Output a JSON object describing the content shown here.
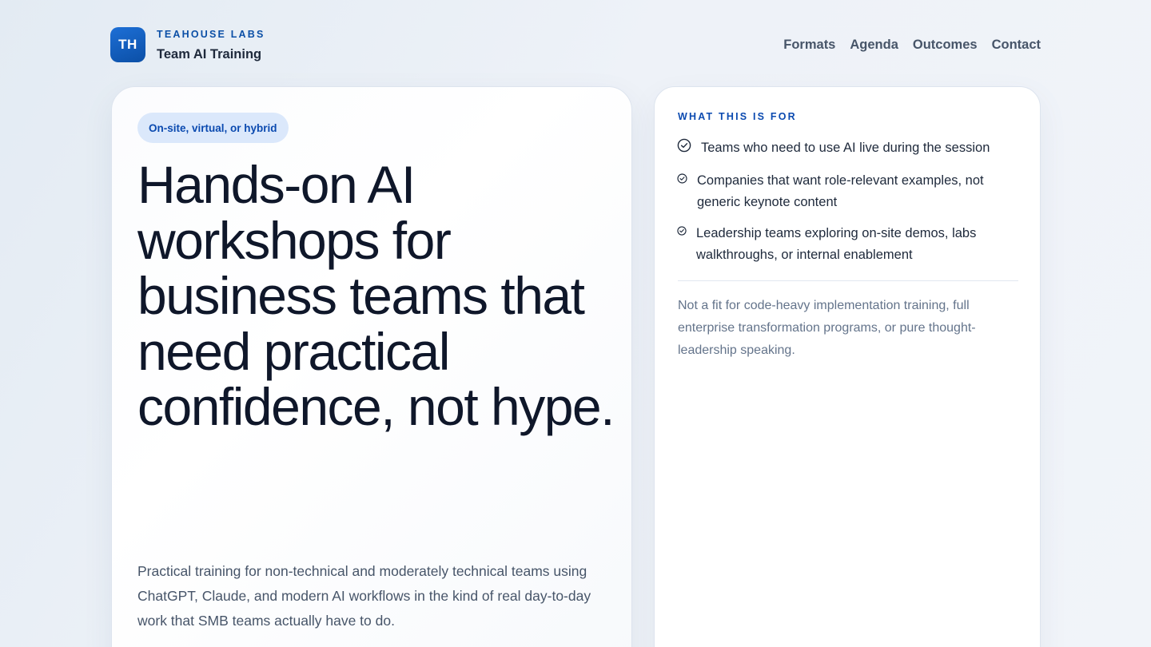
{
  "brand": {
    "logo_initials": "TH",
    "name": "TEAHOUSE LABS",
    "tagline": "Team AI Training",
    "accent_color": "#0b4fa6"
  },
  "nav": {
    "items": [
      {
        "label": "Formats"
      },
      {
        "label": "Agenda"
      },
      {
        "label": "Outcomes"
      },
      {
        "label": "Contact"
      }
    ]
  },
  "hero": {
    "badge": "On-site, virtual, or hybrid",
    "headline": "Hands-on AI workshops for business teams that need practical confidence, not hype.",
    "description": "Practical training for non-technical and moderately technical teams using ChatGPT, Claude, and modern AI workflows in the kind of real day-to-day work that SMB teams actually have to do."
  },
  "fit": {
    "label": "WHAT THIS IS FOR",
    "items": [
      {
        "text": "Teams who need to use AI live during the session",
        "icon": "check-circle-icon"
      },
      {
        "text": "Companies that want role-relevant examples, not generic keynote content",
        "icon": "check-circle-icon"
      },
      {
        "text": "Leadership teams exploring on-site demos, labs walkthroughs, or internal enablement",
        "icon": "check-circle-icon"
      }
    ],
    "note": "Not a fit for code-heavy implementation training, full enterprise transformation programs, or pure thought-leadership speaking."
  }
}
